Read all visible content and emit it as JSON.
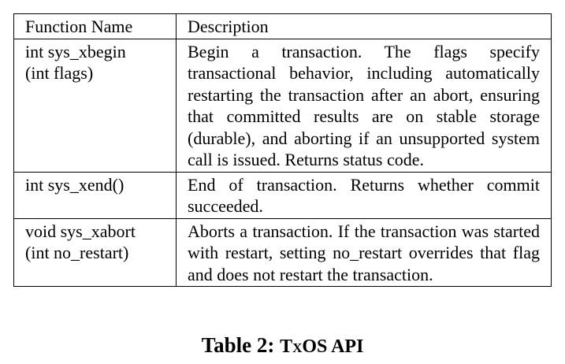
{
  "table": {
    "headers": [
      "Function Name",
      "Description"
    ],
    "rows": [
      {
        "name_lines": [
          "int sys_xbegin",
          "(int flags)"
        ],
        "description": "Begin a transaction. The flags specify transactional behavior, including automatically restarting the transaction after an abort, ensuring that committed results are on stable storage (durable), and aborting if an unsupported system call is issued. Returns status code."
      },
      {
        "name_lines": [
          "int sys_xend()"
        ],
        "description": "End of transaction. Returns whether commit succeeded."
      },
      {
        "name_lines": [
          "void sys_xabort",
          "(int no_restart)"
        ],
        "description": "Aborts a transaction. If the transaction was started with restart, setting no_restart overrides that flag and does not restart the transaction."
      }
    ]
  },
  "caption": {
    "label": "Table 2:",
    "text": "TxOS API"
  }
}
